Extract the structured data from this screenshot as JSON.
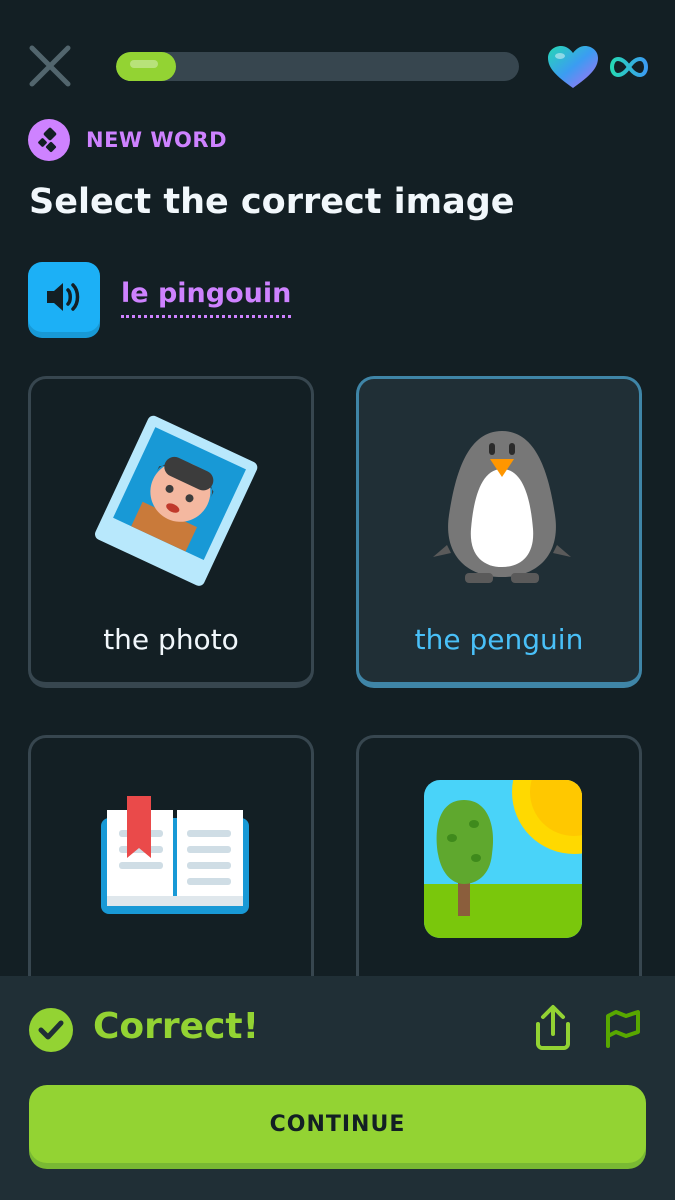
{
  "header": {
    "progress_fraction": 0.15,
    "lives": "infinite",
    "icons": {
      "close": "close-icon",
      "heart": "heart-icon",
      "infinity": "infinity-icon"
    }
  },
  "badge": {
    "label": "NEW WORD",
    "icon": "new-word-icon",
    "color": "#ce82ff"
  },
  "prompt": {
    "title": "Select the correct image",
    "word": "le pingouin",
    "audio_icon": "speaker-icon"
  },
  "choices": [
    {
      "label": "the photo",
      "icon": "photo-icon",
      "selected": false
    },
    {
      "label": "the penguin",
      "icon": "penguin-icon",
      "selected": true
    },
    {
      "label": "",
      "icon": "book-icon",
      "selected": false
    },
    {
      "label": "",
      "icon": "landscape-icon",
      "selected": false
    }
  ],
  "feedback": {
    "status": "Correct!",
    "icons": {
      "check": "check-circle-icon",
      "share": "share-icon",
      "flag": "flag-icon"
    },
    "continue_label": "CONTINUE"
  },
  "colors": {
    "background": "#131f24",
    "panel": "#202f36",
    "accent_green": "#93d333",
    "accent_blue": "#1cb0f6",
    "accent_purple": "#ce82ff",
    "border": "#37464f"
  }
}
